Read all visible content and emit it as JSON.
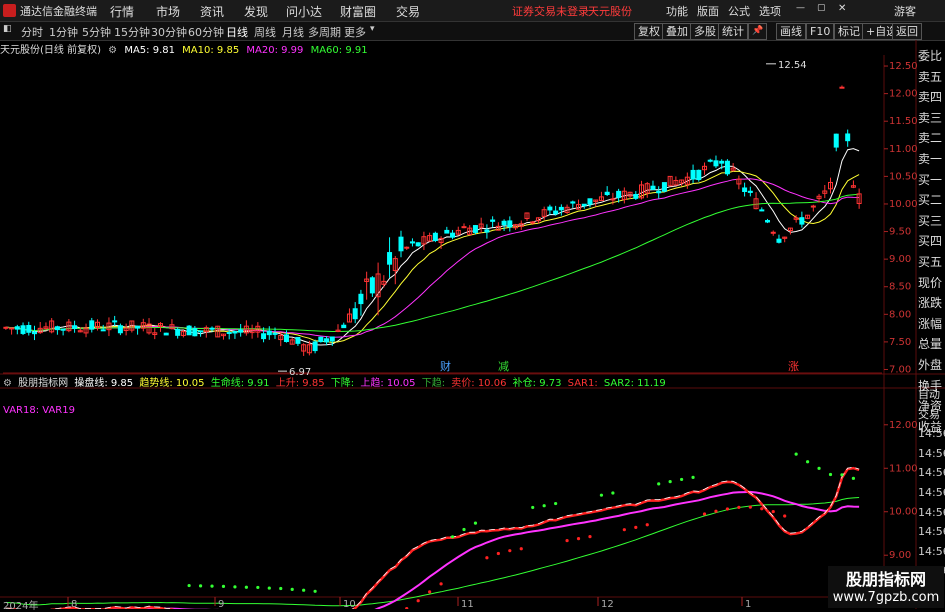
{
  "menubar": {
    "app_title": "通达信金融终端",
    "items": [
      "行情",
      "市场",
      "资讯",
      "发现",
      "问小达",
      "财富圈",
      "交易"
    ],
    "warning": "证券交易未登录",
    "stock": "天元股份",
    "tools": [
      "功能",
      "版面",
      "公式",
      "选项"
    ],
    "guest": "游客"
  },
  "periodbar": {
    "periods": [
      "分时",
      "1分钟",
      "5分钟",
      "15分钟",
      "30分钟",
      "60分钟",
      "日线",
      "周线",
      "月线",
      "多周期",
      "更多"
    ],
    "active": "日线",
    "buttons": [
      "复权",
      "叠加",
      "多股",
      "统计",
      "画线",
      "F10",
      "标记",
      "+自选",
      "返回"
    ]
  },
  "main_legend": {
    "title": "天元股份(日线 前复权)",
    "ma5": "MA5: 9.81",
    "ma10": "MA10: 9.85",
    "ma20": "MA20: 9.99",
    "ma60": "MA60: 9.91"
  },
  "main_axis": [
    "12.50",
    "12.00",
    "11.50",
    "11.00",
    "10.50",
    "10.00",
    "9.50",
    "9.00",
    "8.50",
    "8.00",
    "7.50",
    "7.00"
  ],
  "annotations": {
    "high": "12.54",
    "low": "6.97"
  },
  "event_labels": [
    {
      "text": "财",
      "color": "#4aa0ff"
    },
    {
      "text": "减",
      "color": "#33dd33"
    },
    {
      "text": "涨",
      "color": "#ff3333"
    }
  ],
  "sub_legend": {
    "name": "股朋指标网",
    "items": [
      {
        "label": "操盘线: 9.85",
        "color": "#ffffff"
      },
      {
        "label": "趋势线: 10.05",
        "color": "#ffff33"
      },
      {
        "label": "生命线: 9.91",
        "color": "#33ff33"
      },
      {
        "label": "上升: 9.85",
        "color": "#ff3333"
      },
      {
        "label": "下降: ",
        "color": "#33ff33"
      },
      {
        "label": "上趋: 10.05",
        "color": "#ff33ff"
      },
      {
        "label": "下趋: ",
        "color": "#33aa33"
      },
      {
        "label": "卖价: 10.06",
        "color": "#ff3333"
      },
      {
        "label": "补仓: 9.73",
        "color": "#33ff33"
      },
      {
        "label": "SAR1: ",
        "color": "#ff3333"
      },
      {
        "label": "SAR2: 11.19",
        "color": "#33ff33"
      }
    ],
    "var_label": "VAR18: VAR19"
  },
  "sub_axis": [
    "12.00",
    "11.00",
    "10.00",
    "9.00"
  ],
  "right_panel": [
    "委比",
    "卖五",
    "卖四",
    "卖三",
    "卖二",
    "卖一",
    "买一",
    "买二",
    "买三",
    "买四",
    "买五",
    "现价",
    "涨跌",
    "涨幅",
    "总量",
    "外盘",
    "换手",
    "净资",
    "收益"
  ],
  "right_panel_bottom": [
    "自动",
    "交易",
    "14:56",
    "14:56",
    "14:56",
    "14:56",
    "14:56",
    "14:56",
    "14:56",
    "14:56"
  ],
  "date_axis": {
    "year": "2024年",
    "months": [
      "8",
      "9",
      "10",
      "11",
      "12",
      "1"
    ]
  },
  "watermark": {
    "line1": "股朋指标网",
    "line2": "www.7gpzb.com"
  },
  "colors": {
    "up": "#ff3333",
    "down": "#00ffff",
    "ma5": "#ffffff",
    "ma10": "#ffff33",
    "ma20": "#ff33ff",
    "ma60": "#33ff33"
  }
}
